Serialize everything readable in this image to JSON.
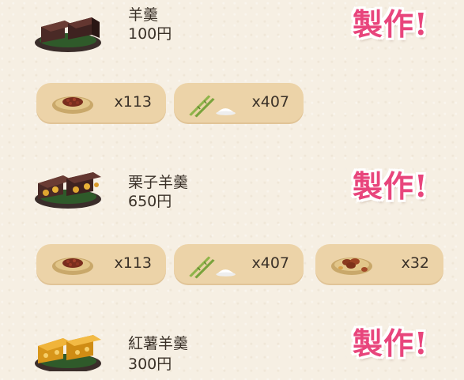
{
  "recipes": [
    {
      "name": "羊羹",
      "price": "100円",
      "make_label": "製作!",
      "ingredients": [
        {
          "icon": "red-beans-plate-icon",
          "qty": "x113"
        },
        {
          "icon": "sugarcane-sugar-icon",
          "qty": "x407"
        }
      ]
    },
    {
      "name": "栗子羊羹",
      "price": "650円",
      "make_label": "製作!",
      "ingredients": [
        {
          "icon": "red-beans-plate-icon",
          "qty": "x113"
        },
        {
          "icon": "sugarcane-sugar-icon",
          "qty": "x407"
        },
        {
          "icon": "chestnut-plate-icon",
          "qty": "x32"
        }
      ]
    },
    {
      "name": "紅薯羊羹",
      "price": "300円",
      "make_label": "製作!",
      "ingredients": []
    }
  ],
  "colors": {
    "background": "#f6efe3",
    "pill": "#ecd3a8",
    "make_button": "#e8457c"
  }
}
